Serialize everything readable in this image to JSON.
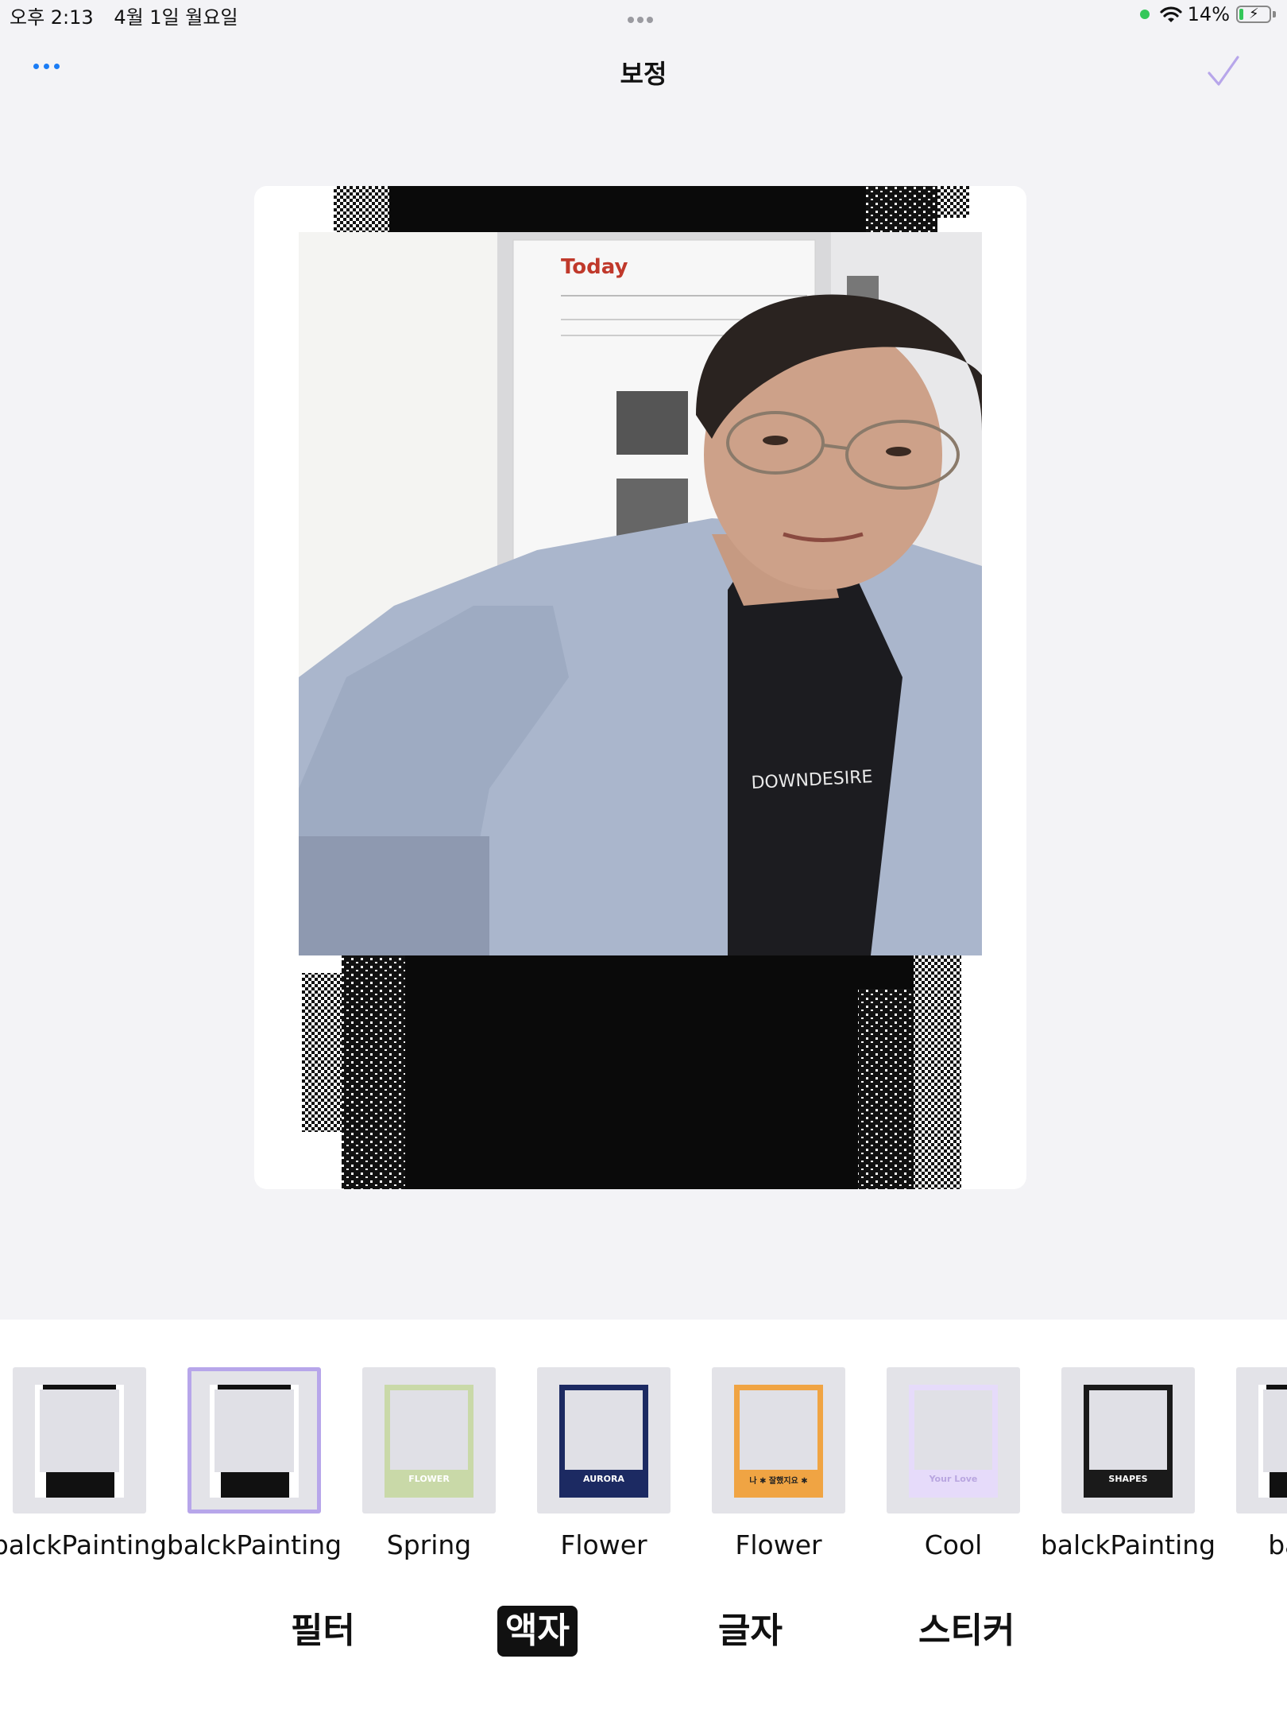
{
  "status_bar": {
    "time": "오후 2:13",
    "date": "4월 1일 월요일",
    "battery": "14%",
    "battery_level": 0.14
  },
  "nav": {
    "title": "보정"
  },
  "frames": [
    {
      "label": "balckPainting",
      "selected": false,
      "style": "black"
    },
    {
      "label": "balckPainting",
      "selected": true,
      "style": "black"
    },
    {
      "label": "Spring",
      "selected": false,
      "style": "spring",
      "caption": "FLOWER"
    },
    {
      "label": "Flower",
      "selected": false,
      "style": "aurora",
      "caption": "AURORA"
    },
    {
      "label": "Flower",
      "selected": false,
      "style": "orange",
      "caption": "나 ✱ 잘했지요 ✱"
    },
    {
      "label": "Cool",
      "selected": false,
      "style": "lavender",
      "caption": "Your Love"
    },
    {
      "label": "balckPainting",
      "selected": false,
      "style": "shapes",
      "caption": "SHAPES"
    },
    {
      "label": "balck",
      "selected": false,
      "style": "black"
    }
  ],
  "tabs": [
    {
      "label": "필터",
      "active": false
    },
    {
      "label": "액자",
      "active": true
    },
    {
      "label": "글자",
      "active": false
    },
    {
      "label": "스티커",
      "active": false
    }
  ],
  "photo": {
    "poster_title": "Today",
    "shirt_text": "DOWNDESIRE"
  },
  "colors": {
    "accent": "#1a7cf5",
    "selected_border": "#b7a6ea",
    "checkmark": "#b7a6ea"
  }
}
